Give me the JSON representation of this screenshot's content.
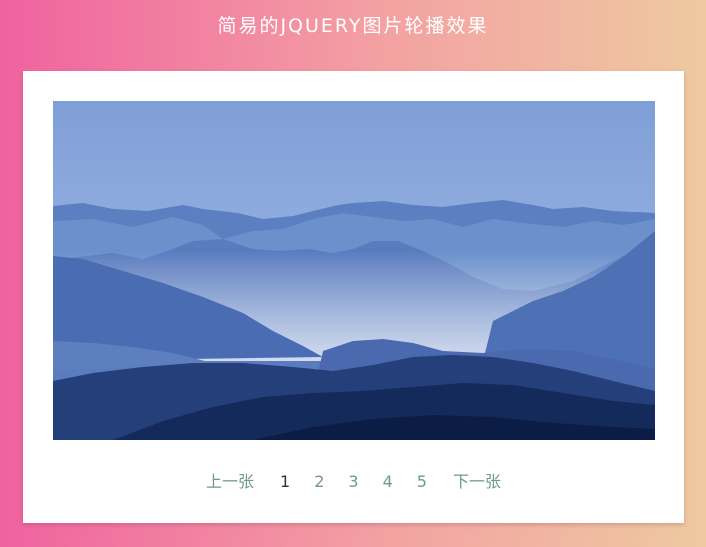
{
  "page": {
    "title": "简易的JQUERY图片轮播效果"
  },
  "carousel": {
    "image": {
      "alt": "blue misty mountain ranges",
      "icon": "landscape-image"
    },
    "pager": {
      "prev_label": "上一张",
      "next_label": "下一张",
      "pages": [
        "1",
        "2",
        "3",
        "4",
        "5"
      ],
      "current": "1"
    }
  },
  "colors": {
    "gradient_start": "#f062a0",
    "gradient_mid": "#f3a2a2",
    "gradient_end": "#eec9a0",
    "pager_link": "#6f9a86",
    "pager_current": "#333333"
  }
}
